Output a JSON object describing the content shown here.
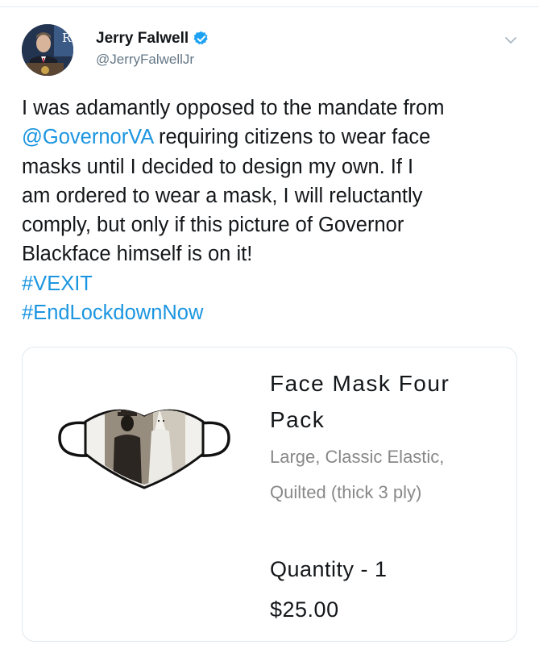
{
  "tweet": {
    "author": {
      "name": "Jerry Falwell",
      "handle": "@JerryFalwellJr",
      "avatar_letter": "R",
      "verified_color": "#1da1f2"
    },
    "text_lines": [
      [
        {
          "text": "I was adamantly opposed to the mandate from",
          "type": "text"
        }
      ],
      [
        {
          "text": "@GovernorVA",
          "type": "mention"
        },
        {
          "text": " requiring citizens to wear face",
          "type": "text"
        }
      ],
      [
        {
          "text": "masks until I decided to design my own. If I",
          "type": "text"
        }
      ],
      [
        {
          "text": "am ordered to wear a mask, I will reluctantly",
          "type": "text"
        }
      ],
      [
        {
          "text": "comply, but only if this picture of Governor",
          "type": "text"
        }
      ],
      [
        {
          "text": "Blackface himself is on it!",
          "type": "text"
        }
      ],
      [
        {
          "text": "#VEXIT",
          "type": "hashtag"
        }
      ],
      [
        {
          "text": "#EndLockdownNow",
          "type": "hashtag"
        }
      ]
    ],
    "link_color": "#1b95e0"
  },
  "card": {
    "title_lines": [
      "Face Mask Four",
      "Pack"
    ],
    "description_lines": [
      "Large, Classic Elastic,",
      "Quilted (thick 3 ply)"
    ],
    "quantity": "Quantity - 1",
    "price": "$25.00"
  }
}
